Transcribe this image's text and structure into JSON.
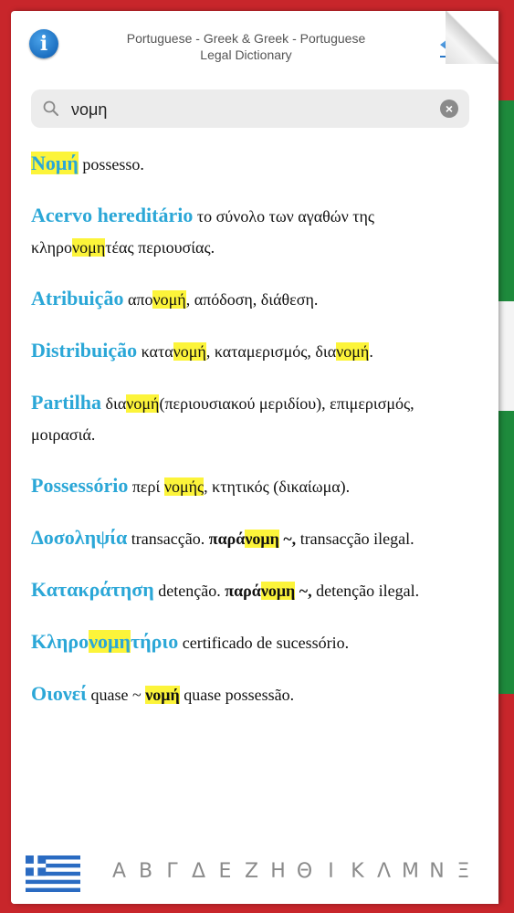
{
  "header": {
    "title_line1": "Portuguese - Greek & Greek - Portuguese",
    "title_line2": "Legal Dictionary",
    "info_label": "i"
  },
  "search": {
    "value": "νομη",
    "placeholder": ""
  },
  "entries": [
    {
      "segments": [
        {
          "t": "Νομή",
          "k": "term-hl"
        },
        {
          "t": " possesso.",
          "k": ""
        }
      ]
    },
    {
      "segments": [
        {
          "t": "Acervo hereditário",
          "k": "term"
        },
        {
          "t": " το σύνολο των αγαθών της κληρο",
          "k": ""
        },
        {
          "t": "νομη",
          "k": "hl"
        },
        {
          "t": "τέας περιουσίας.",
          "k": ""
        }
      ]
    },
    {
      "segments": [
        {
          "t": "Atribuição",
          "k": "term"
        },
        {
          "t": " απο",
          "k": ""
        },
        {
          "t": "νομή",
          "k": "hl"
        },
        {
          "t": ", απόδοση, διάθεση.",
          "k": ""
        }
      ]
    },
    {
      "segments": [
        {
          "t": "Distribuição",
          "k": "term"
        },
        {
          "t": " κατα",
          "k": ""
        },
        {
          "t": "νομή",
          "k": "hl"
        },
        {
          "t": ", καταμερισμός, δια",
          "k": ""
        },
        {
          "t": "νομή",
          "k": "hl"
        },
        {
          "t": ".",
          "k": ""
        }
      ]
    },
    {
      "segments": [
        {
          "t": "Partilha",
          "k": "term"
        },
        {
          "t": " δια",
          "k": ""
        },
        {
          "t": "νομή",
          "k": "hl"
        },
        {
          "t": "(περιουσιακού μεριδίου), επιμερισμός, μοιρασιά.",
          "k": ""
        }
      ]
    },
    {
      "segments": [
        {
          "t": "Possessório",
          "k": "term"
        },
        {
          "t": " περί ",
          "k": ""
        },
        {
          "t": "νομής",
          "k": "hl"
        },
        {
          "t": ", κτητικός (δικαίωμα).",
          "k": ""
        }
      ]
    },
    {
      "segments": [
        {
          "t": "Δοσοληψία",
          "k": "term"
        },
        {
          "t": " transacção. ",
          "k": ""
        },
        {
          "t": "παρά",
          "k": "b"
        },
        {
          "t": "νομη",
          "k": "b-hl"
        },
        {
          "t": " ~,",
          "k": "b"
        },
        {
          "t": " transacção ilegal.",
          "k": ""
        }
      ]
    },
    {
      "segments": [
        {
          "t": "Κατακράτηση",
          "k": "term"
        },
        {
          "t": " detenção. ",
          "k": ""
        },
        {
          "t": "παρά",
          "k": "b"
        },
        {
          "t": "νομη",
          "k": "b-hl"
        },
        {
          "t": " ~,",
          "k": "b"
        },
        {
          "t": " detenção ilegal.",
          "k": ""
        }
      ]
    },
    {
      "segments": [
        {
          "t": "Κληρο",
          "k": "term"
        },
        {
          "t": "νομη",
          "k": "term-hl"
        },
        {
          "t": "τήριο",
          "k": "term"
        },
        {
          "t": " certificado de sucessório.",
          "k": ""
        }
      ]
    },
    {
      "segments": [
        {
          "t": "Οιονεί",
          "k": "term"
        },
        {
          "t": " quase ~ ",
          "k": ""
        },
        {
          "t": "νομή",
          "k": "b-hl"
        },
        {
          "t": " quase possessão.",
          "k": ""
        }
      ]
    }
  ],
  "footer": {
    "alphabet": [
      "Α",
      "Β",
      "Γ",
      "Δ",
      "Ε",
      "Ζ",
      "Η",
      "Θ",
      "Ι",
      "Κ",
      "Λ",
      "Μ",
      "Ν",
      "Ξ"
    ]
  },
  "colors": {
    "term": "#2ba7d7",
    "highlight": "#fcf43a",
    "frame_red": "#c8262b",
    "frame_green": "#1e8a3c",
    "greek_blue": "#2a6bc2"
  },
  "icons": [
    "info-icon",
    "back-arrow-icon",
    "search-icon",
    "clear-icon",
    "greek-flag-icon"
  ]
}
